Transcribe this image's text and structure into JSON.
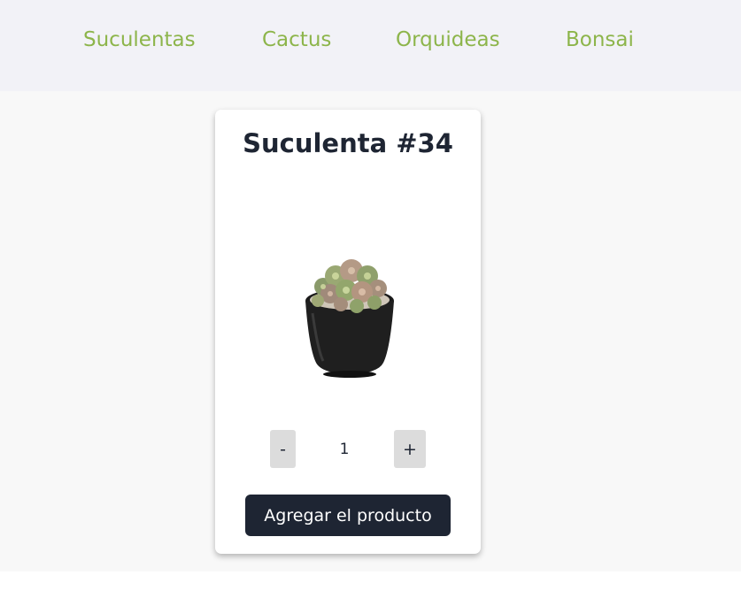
{
  "nav": {
    "items": [
      {
        "label": "Suculentas"
      },
      {
        "label": "Cactus"
      },
      {
        "label": "Orquideas"
      },
      {
        "label": "Bonsai"
      }
    ],
    "link_color": "#8db54b"
  },
  "product": {
    "title": "Suculenta #34",
    "image_icon": "potted-succulent-image",
    "quantity": {
      "decrement_label": "-",
      "value": "1",
      "increment_label": "+"
    },
    "add_button_label": "Agregar el producto"
  },
  "colors": {
    "nav_background": "#f2f2f7",
    "page_background": "#f8f8f8",
    "primary_dark": "#1e2533",
    "quantity_button": "#dcdcdc"
  }
}
